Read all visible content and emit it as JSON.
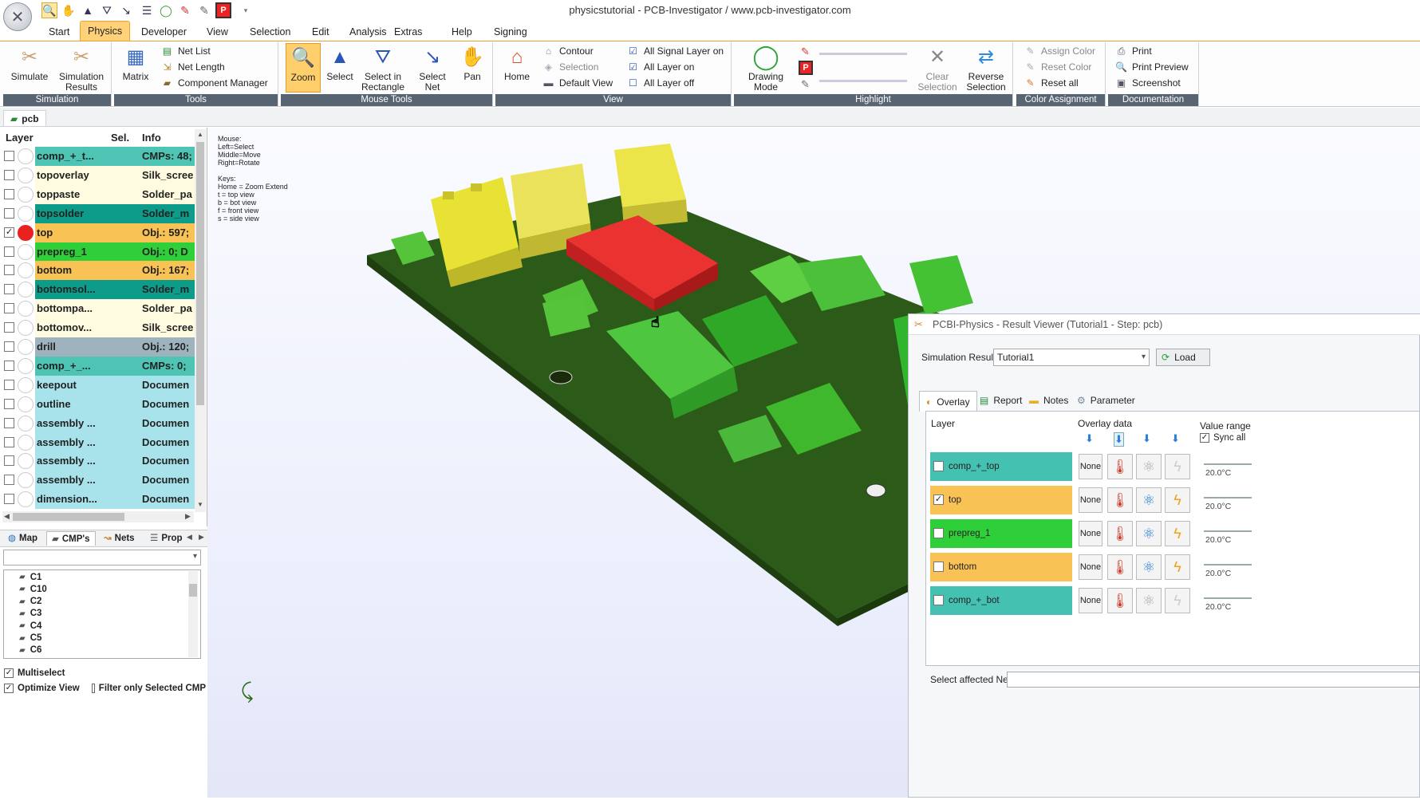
{
  "window": {
    "title": "physicstutorial - PCB-Investigator / www.pcb-investigator.com"
  },
  "quick_access": [
    "search-icon",
    "hand-icon",
    "select-arrow-icon",
    "select-rect-icon",
    "select-net-icon",
    "contour-icon",
    "drawing-mode-icon",
    "pen-icon",
    "pen2-icon",
    "highlight-icon",
    "dropdown-icon"
  ],
  "menu": [
    "Start",
    "Physics",
    "Developer",
    "View",
    "Selection",
    "Edit",
    "Analysis",
    "Extras",
    "Help",
    "Signing"
  ],
  "ribbon": {
    "simulation": {
      "label": "Simulation",
      "simulate": "Simulate",
      "results_1": "Simulation",
      "results_2": "Results"
    },
    "tools": {
      "label": "Tools",
      "matrix": "Matrix",
      "net_list": "Net List",
      "net_length": "Net Length",
      "component_manager": "Component Manager"
    },
    "mouse_tools": {
      "label": "Mouse Tools",
      "zoom": "Zoom",
      "select": "Select",
      "select_rect_1": "Select in",
      "select_rect_2": "Rectangle",
      "select_net_1": "Select",
      "select_net_2": "Net",
      "pan": "Pan"
    },
    "view": {
      "label": "View",
      "home": "Home",
      "contour": "Contour",
      "selection": "Selection",
      "default_view": "Default View",
      "all_signal_on": "All Signal Layer on",
      "all_layer_on": "All Layer on",
      "all_layer_off": "All Layer off"
    },
    "highlight": {
      "label": "Highlight",
      "drawing_mode_1": "Drawing",
      "drawing_mode_2": "Mode",
      "clear_1": "Clear",
      "clear_2": "Selection",
      "reverse_1": "Reverse",
      "reverse_2": "Selection"
    },
    "color_assignment": {
      "label": "Color Assignment",
      "assign": "Assign Color",
      "reset": "Reset Color",
      "reset_all": "Reset all"
    },
    "documentation": {
      "label": "Documentation",
      "print": "Print",
      "preview": "Print Preview",
      "screenshot": "Screenshot"
    }
  },
  "doc_tab": "pcb",
  "layer_panel": {
    "headers": {
      "layer": "Layer",
      "sel": "Sel.",
      "info": "Info"
    },
    "rows": [
      {
        "name": "comp_+_t...",
        "info": "CMPs: 48;",
        "checked": false,
        "color": "#4ec4b4",
        "infocolor": "#4ec4b4",
        "dot": "#fff"
      },
      {
        "name": "topoverlay",
        "info": "Silk_scree",
        "checked": false,
        "color": "#fffbe0",
        "infocolor": "#fffbe0",
        "dot": "#fff"
      },
      {
        "name": "toppaste",
        "info": "Solder_pa",
        "checked": false,
        "color": "#fffbe0",
        "infocolor": "#fffbe0",
        "dot": "#fff"
      },
      {
        "name": "topsolder",
        "info": "Solder_m",
        "checked": false,
        "color": "#0d9b8a",
        "infocolor": "#0d9b8a",
        "dot": "#fff"
      },
      {
        "name": "top",
        "info": "Obj.: 597;",
        "checked": true,
        "color": "#f9c254",
        "infocolor": "#f9c254",
        "dot": "#e8231f"
      },
      {
        "name": "prepreg_1",
        "info": "Obj.: 0; D",
        "checked": false,
        "color": "#2fcf3a",
        "infocolor": "#2fcf3a",
        "dot": "#fff"
      },
      {
        "name": "bottom",
        "info": "Obj.: 167;",
        "checked": false,
        "color": "#f9c254",
        "infocolor": "#f9c254",
        "dot": "#fff"
      },
      {
        "name": "bottomsol...",
        "info": "Solder_m",
        "checked": false,
        "color": "#0d9b8a",
        "infocolor": "#0d9b8a",
        "dot": "#fff"
      },
      {
        "name": "bottompa...",
        "info": "Solder_pa",
        "checked": false,
        "color": "#fffbe0",
        "infocolor": "#fffbe0",
        "dot": "#fff"
      },
      {
        "name": "bottomov...",
        "info": "Silk_scree",
        "checked": false,
        "color": "#fffbe0",
        "infocolor": "#fffbe0",
        "dot": "#fff"
      },
      {
        "name": "drill",
        "info": "Obj.: 120;",
        "checked": false,
        "color": "#9fb3bf",
        "infocolor": "#9fb3bf",
        "dot": "#fff"
      },
      {
        "name": "comp_+_...",
        "info": "CMPs: 0; ",
        "checked": false,
        "color": "#4ec4b4",
        "infocolor": "#4ec4b4",
        "dot": "#fff"
      },
      {
        "name": "keepout",
        "info": "Documen",
        "checked": false,
        "color": "#a8e3ec",
        "infocolor": "#a8e3ec",
        "dot": "#fff"
      },
      {
        "name": "outline",
        "info": "Documen",
        "checked": false,
        "color": "#a8e3ec",
        "infocolor": "#a8e3ec",
        "dot": "#fff"
      },
      {
        "name": "assembly ...",
        "info": "Documen",
        "checked": false,
        "color": "#a8e3ec",
        "infocolor": "#a8e3ec",
        "dot": "#fff"
      },
      {
        "name": "assembly ...",
        "info": "Documen",
        "checked": false,
        "color": "#a8e3ec",
        "infocolor": "#a8e3ec",
        "dot": "#fff"
      },
      {
        "name": "assembly ...",
        "info": "Documen",
        "checked": false,
        "color": "#a8e3ec",
        "infocolor": "#a8e3ec",
        "dot": "#fff"
      },
      {
        "name": "assembly ...",
        "info": "Documen",
        "checked": false,
        "color": "#a8e3ec",
        "infocolor": "#a8e3ec",
        "dot": "#fff"
      },
      {
        "name": "dimension...",
        "info": "Documen",
        "checked": false,
        "color": "#a8e3ec",
        "infocolor": "#a8e3ec",
        "dot": "#fff"
      }
    ]
  },
  "bottom_tabs": [
    {
      "label": "Map",
      "icon": "globe-icon"
    },
    {
      "label": "CMP's",
      "icon": "chip-icon"
    },
    {
      "label": "Nets",
      "icon": "net-icon"
    },
    {
      "label": "Prop",
      "icon": "properties-icon"
    }
  ],
  "components": [
    "C1",
    "C10",
    "C2",
    "C3",
    "C4",
    "C5",
    "C6"
  ],
  "options": {
    "multiselect": "Multiselect",
    "optimize_view": "Optimize View",
    "filter_selected": "Filter only Selected CMP"
  },
  "viewport": {
    "mouse_help": "Mouse:\nLeft=Select\nMiddle=Move\nRight=Rotate\n\nKeys:\nHome = Zoom Extend\nt = top view\nb = bot view\nf = front view\ns = side view"
  },
  "result_viewer": {
    "title": "PCBI-Physics - Result Viewer (Tutorial1 - Step: pcb)",
    "sim_result_label": "Simulation Result:",
    "sim_result_value": "Tutorial1",
    "load": "Load",
    "tabs": [
      "Overlay",
      "Report",
      "Notes",
      "Parameter"
    ],
    "layer_header": "Layer",
    "overlay_header": "Overlay data",
    "value_range_header": "Value range",
    "sync_all": "Sync all",
    "none_label": "None",
    "rows": [
      {
        "name": "comp_+_top",
        "checked": false,
        "color": "#45c1b1",
        "value": "20.0°C",
        "lightning": false,
        "atom": false
      },
      {
        "name": "top",
        "checked": true,
        "color": "#f9c254",
        "value": "20.0°C",
        "lightning": true,
        "atom": true
      },
      {
        "name": "prepreg_1",
        "checked": false,
        "color": "#2fcf3a",
        "value": "20.0°C",
        "lightning": true,
        "atom": true
      },
      {
        "name": "bottom",
        "checked": false,
        "color": "#f9c254",
        "value": "20.0°C",
        "lightning": true,
        "atom": true
      },
      {
        "name": "comp_+_bot",
        "checked": false,
        "color": "#45c1b1",
        "value": "20.0°C",
        "lightning": false,
        "atom": false
      }
    ],
    "affected_net_label": "Select affected Net:"
  }
}
